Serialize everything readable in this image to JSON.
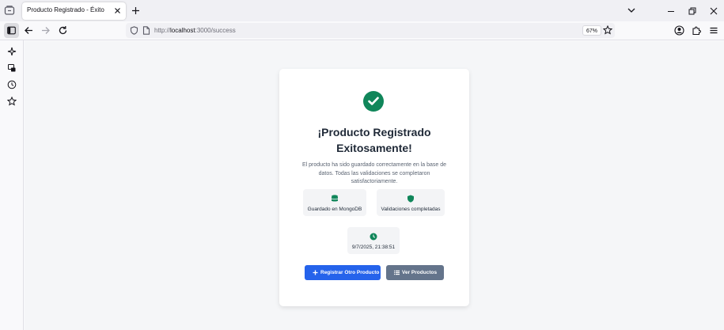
{
  "browser": {
    "tab_title": "Producto Registrado - Éxito",
    "url_prefix": "http://",
    "url_host": "localhost",
    "url_path": ":3000/success",
    "zoom": "67%"
  },
  "icons": {
    "tab_menu": "tab-overview-icon",
    "sidebar_items": [
      "ai-sparkle-icon",
      "synced-tabs-icon",
      "history-icon",
      "bookmarks-star-icon"
    ]
  },
  "page": {
    "title": "¡Producto Registrado Exitosamente!",
    "description": "El producto ha sido guardado correctamente en la base de datos. Todas las validaciones se completaron satisfactoriamente.",
    "info": {
      "saved": "Guardado en MongoDB",
      "validations": "Validaciones completadas",
      "timestamp": "9/7/2025, 21:38:51"
    },
    "buttons": {
      "register_another": "Registrar Otro Producto",
      "view_products": "Ver Productos"
    }
  },
  "colors": {
    "success": "#10865a",
    "primary": "#2563eb",
    "secondary": "#64748b"
  }
}
